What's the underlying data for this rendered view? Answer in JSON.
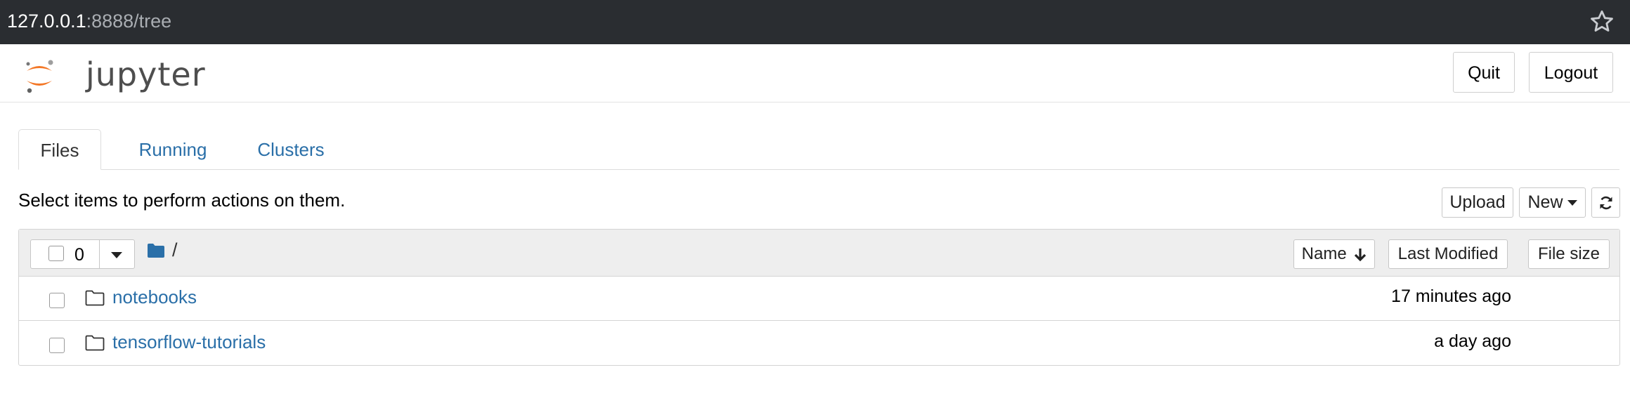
{
  "browser": {
    "url_host": "127.0.0.1",
    "url_rest": ":8888/tree",
    "bookmark_icon": "star-icon"
  },
  "header": {
    "logo_text": "jupyter",
    "quit_label": "Quit",
    "logout_label": "Logout",
    "brand_color": "#f37726"
  },
  "tabs": [
    {
      "label": "Files",
      "active": true
    },
    {
      "label": "Running",
      "active": false
    },
    {
      "label": "Clusters",
      "active": false
    }
  ],
  "toolbar": {
    "hint": "Select items to perform actions on them.",
    "upload_label": "Upload",
    "new_label": "New",
    "refresh_icon": "refresh-icon"
  },
  "list_header": {
    "selected_count": "0",
    "breadcrumb": "/",
    "sort_name_label": "Name",
    "sort_modified_label": "Last Modified",
    "sort_size_label": "File size"
  },
  "items": [
    {
      "name": "notebooks",
      "modified": "17 minutes ago",
      "type": "folder"
    },
    {
      "name": "tensorflow-tutorials",
      "modified": "a day ago",
      "type": "folder"
    }
  ],
  "colors": {
    "link": "#2a6fa8",
    "folder_blue": "#2a6fa8",
    "addr_bar": "#2a2d31"
  }
}
